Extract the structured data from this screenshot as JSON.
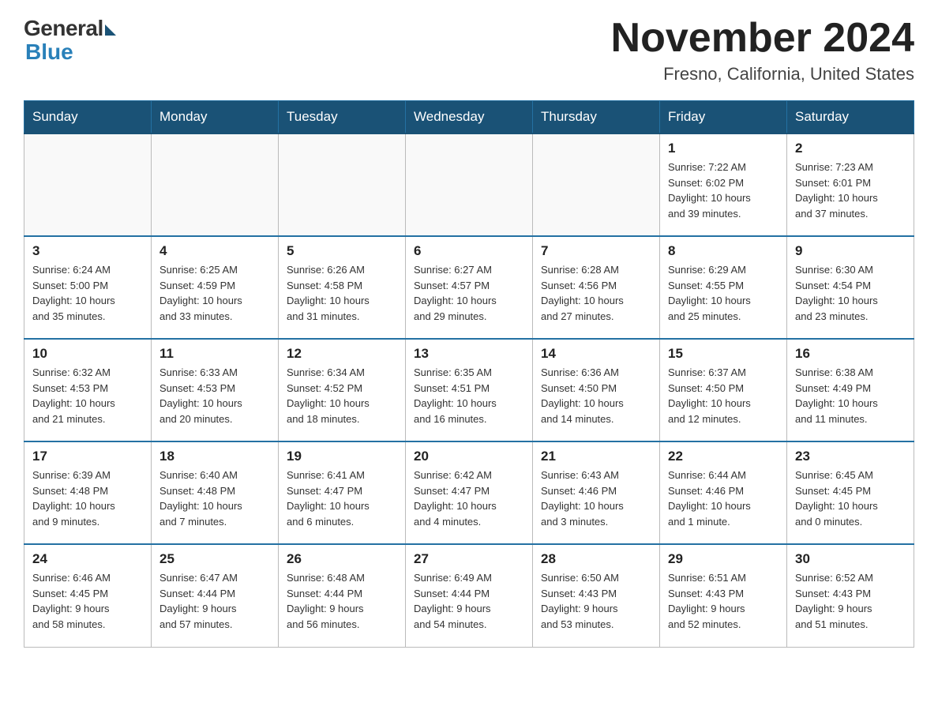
{
  "logo": {
    "general": "General",
    "blue": "Blue"
  },
  "title": "November 2024",
  "location": "Fresno, California, United States",
  "weekdays": [
    "Sunday",
    "Monday",
    "Tuesday",
    "Wednesday",
    "Thursday",
    "Friday",
    "Saturday"
  ],
  "weeks": [
    [
      {
        "day": "",
        "info": ""
      },
      {
        "day": "",
        "info": ""
      },
      {
        "day": "",
        "info": ""
      },
      {
        "day": "",
        "info": ""
      },
      {
        "day": "",
        "info": ""
      },
      {
        "day": "1",
        "info": "Sunrise: 7:22 AM\nSunset: 6:02 PM\nDaylight: 10 hours\nand 39 minutes."
      },
      {
        "day": "2",
        "info": "Sunrise: 7:23 AM\nSunset: 6:01 PM\nDaylight: 10 hours\nand 37 minutes."
      }
    ],
    [
      {
        "day": "3",
        "info": "Sunrise: 6:24 AM\nSunset: 5:00 PM\nDaylight: 10 hours\nand 35 minutes."
      },
      {
        "day": "4",
        "info": "Sunrise: 6:25 AM\nSunset: 4:59 PM\nDaylight: 10 hours\nand 33 minutes."
      },
      {
        "day": "5",
        "info": "Sunrise: 6:26 AM\nSunset: 4:58 PM\nDaylight: 10 hours\nand 31 minutes."
      },
      {
        "day": "6",
        "info": "Sunrise: 6:27 AM\nSunset: 4:57 PM\nDaylight: 10 hours\nand 29 minutes."
      },
      {
        "day": "7",
        "info": "Sunrise: 6:28 AM\nSunset: 4:56 PM\nDaylight: 10 hours\nand 27 minutes."
      },
      {
        "day": "8",
        "info": "Sunrise: 6:29 AM\nSunset: 4:55 PM\nDaylight: 10 hours\nand 25 minutes."
      },
      {
        "day": "9",
        "info": "Sunrise: 6:30 AM\nSunset: 4:54 PM\nDaylight: 10 hours\nand 23 minutes."
      }
    ],
    [
      {
        "day": "10",
        "info": "Sunrise: 6:32 AM\nSunset: 4:53 PM\nDaylight: 10 hours\nand 21 minutes."
      },
      {
        "day": "11",
        "info": "Sunrise: 6:33 AM\nSunset: 4:53 PM\nDaylight: 10 hours\nand 20 minutes."
      },
      {
        "day": "12",
        "info": "Sunrise: 6:34 AM\nSunset: 4:52 PM\nDaylight: 10 hours\nand 18 minutes."
      },
      {
        "day": "13",
        "info": "Sunrise: 6:35 AM\nSunset: 4:51 PM\nDaylight: 10 hours\nand 16 minutes."
      },
      {
        "day": "14",
        "info": "Sunrise: 6:36 AM\nSunset: 4:50 PM\nDaylight: 10 hours\nand 14 minutes."
      },
      {
        "day": "15",
        "info": "Sunrise: 6:37 AM\nSunset: 4:50 PM\nDaylight: 10 hours\nand 12 minutes."
      },
      {
        "day": "16",
        "info": "Sunrise: 6:38 AM\nSunset: 4:49 PM\nDaylight: 10 hours\nand 11 minutes."
      }
    ],
    [
      {
        "day": "17",
        "info": "Sunrise: 6:39 AM\nSunset: 4:48 PM\nDaylight: 10 hours\nand 9 minutes."
      },
      {
        "day": "18",
        "info": "Sunrise: 6:40 AM\nSunset: 4:48 PM\nDaylight: 10 hours\nand 7 minutes."
      },
      {
        "day": "19",
        "info": "Sunrise: 6:41 AM\nSunset: 4:47 PM\nDaylight: 10 hours\nand 6 minutes."
      },
      {
        "day": "20",
        "info": "Sunrise: 6:42 AM\nSunset: 4:47 PM\nDaylight: 10 hours\nand 4 minutes."
      },
      {
        "day": "21",
        "info": "Sunrise: 6:43 AM\nSunset: 4:46 PM\nDaylight: 10 hours\nand 3 minutes."
      },
      {
        "day": "22",
        "info": "Sunrise: 6:44 AM\nSunset: 4:46 PM\nDaylight: 10 hours\nand 1 minute."
      },
      {
        "day": "23",
        "info": "Sunrise: 6:45 AM\nSunset: 4:45 PM\nDaylight: 10 hours\nand 0 minutes."
      }
    ],
    [
      {
        "day": "24",
        "info": "Sunrise: 6:46 AM\nSunset: 4:45 PM\nDaylight: 9 hours\nand 58 minutes."
      },
      {
        "day": "25",
        "info": "Sunrise: 6:47 AM\nSunset: 4:44 PM\nDaylight: 9 hours\nand 57 minutes."
      },
      {
        "day": "26",
        "info": "Sunrise: 6:48 AM\nSunset: 4:44 PM\nDaylight: 9 hours\nand 56 minutes."
      },
      {
        "day": "27",
        "info": "Sunrise: 6:49 AM\nSunset: 4:44 PM\nDaylight: 9 hours\nand 54 minutes."
      },
      {
        "day": "28",
        "info": "Sunrise: 6:50 AM\nSunset: 4:43 PM\nDaylight: 9 hours\nand 53 minutes."
      },
      {
        "day": "29",
        "info": "Sunrise: 6:51 AM\nSunset: 4:43 PM\nDaylight: 9 hours\nand 52 minutes."
      },
      {
        "day": "30",
        "info": "Sunrise: 6:52 AM\nSunset: 4:43 PM\nDaylight: 9 hours\nand 51 minutes."
      }
    ]
  ]
}
